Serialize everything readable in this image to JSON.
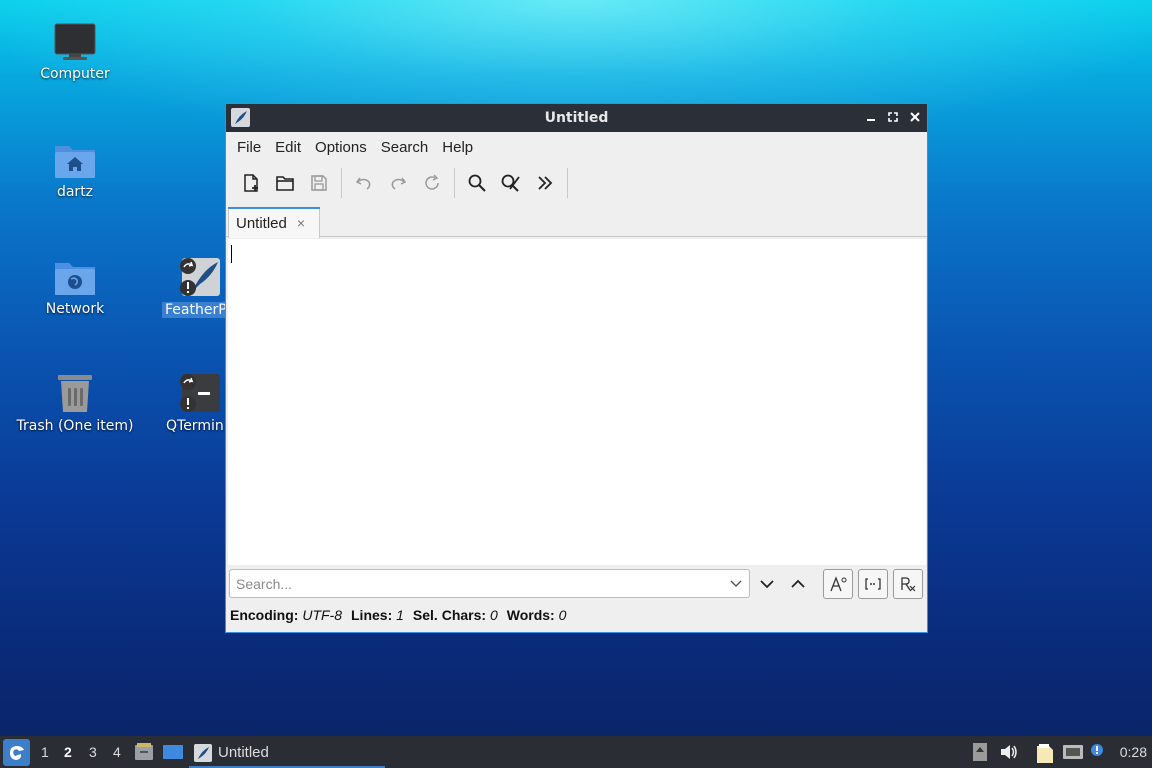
{
  "desktop": {
    "icons": [
      {
        "label": "Computer"
      },
      {
        "label": "dartz"
      },
      {
        "label": "Network"
      },
      {
        "label": "Trash (One item)"
      },
      {
        "label": "FeatherP"
      },
      {
        "label": "QTermin"
      }
    ]
  },
  "window": {
    "title": "Untitled",
    "menu": [
      "File",
      "Edit",
      "Options",
      "Search",
      "Help"
    ],
    "tab": {
      "label": "Untitled",
      "close": "×"
    },
    "search": {
      "placeholder": "Search..."
    },
    "status": {
      "encoding_label": "Encoding:",
      "encoding_value": "UTF-8",
      "lines_label": "Lines:",
      "lines_value": "1",
      "sel_label": "Sel. Chars:",
      "sel_value": "0",
      "words_label": "Words:",
      "words_value": "0"
    }
  },
  "taskbar": {
    "workspaces": [
      "1",
      "2",
      "3",
      "4"
    ],
    "active_workspace": "2",
    "task_label": "Untitled",
    "clock": "0:28"
  },
  "colors": {
    "accent": "#3c8ee0",
    "titlebar": "#2b2f38",
    "taskbar": "#2a2d34"
  }
}
